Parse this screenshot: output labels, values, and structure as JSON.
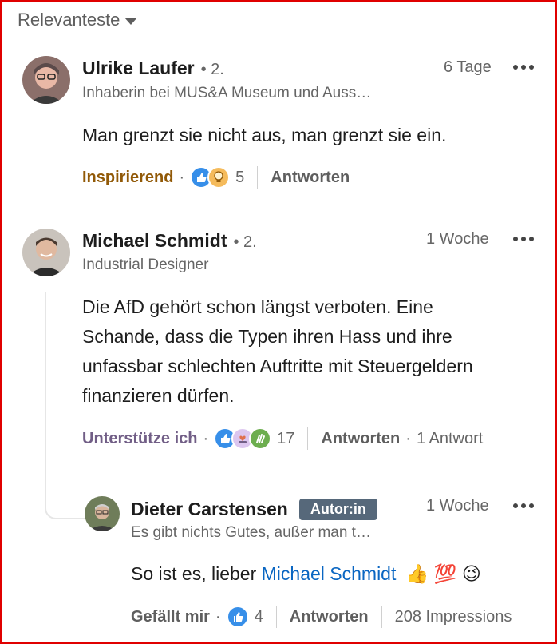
{
  "sort": {
    "label": "Relevanteste"
  },
  "colors": {
    "inspiring": "#915907",
    "support": "#715e86",
    "like_blue": "#378fe9",
    "author_badge": "#56687a",
    "mention": "#0a66c2"
  },
  "comments": [
    {
      "name": "Ulrike Laufer",
      "degree": "• 2.",
      "headline": "Inhaberin bei MUS&A Museum und Auss…",
      "time": "6 Tage",
      "text": "Man grenzt sie nicht aus, man grenzt sie ein.",
      "reaction_label": "Inspirierend",
      "reaction_icons": [
        "like-icon",
        "lightbulb-icon"
      ],
      "reaction_count": "5",
      "reply_label": "Antworten"
    },
    {
      "name": "Michael Schmidt",
      "degree": "• 2.",
      "headline": "Industrial Designer",
      "time": "1 Woche",
      "text_lines": [
        "Die AfD gehört schon längst verboten. Eine",
        "Schande, dass die Typen ihren Hass und ihre",
        "unfassbar schlechten Auftritte mit Steuergeldern",
        "finanzieren dürfen."
      ],
      "reaction_label": "Unterstütze ich",
      "reaction_icons": [
        "like-icon",
        "heart-hand-icon",
        "clap-icon"
      ],
      "reaction_count": "17",
      "reply_label": "Antworten",
      "reply_count": "1 Antwort"
    },
    {
      "name": "Dieter Carstensen",
      "badge": "Autor:in",
      "headline": "Es gibt nichts Gutes, außer man t…",
      "time": "1 Woche",
      "text_prefix": "So ist es, lieber ",
      "mention": "Michael Schmidt",
      "emojis": "👍 💯 😉",
      "reaction_label": "Gefällt mir",
      "reaction_icons": [
        "like-icon"
      ],
      "reaction_count": "4",
      "reply_label": "Antworten",
      "impressions": "208 Impressions"
    }
  ]
}
